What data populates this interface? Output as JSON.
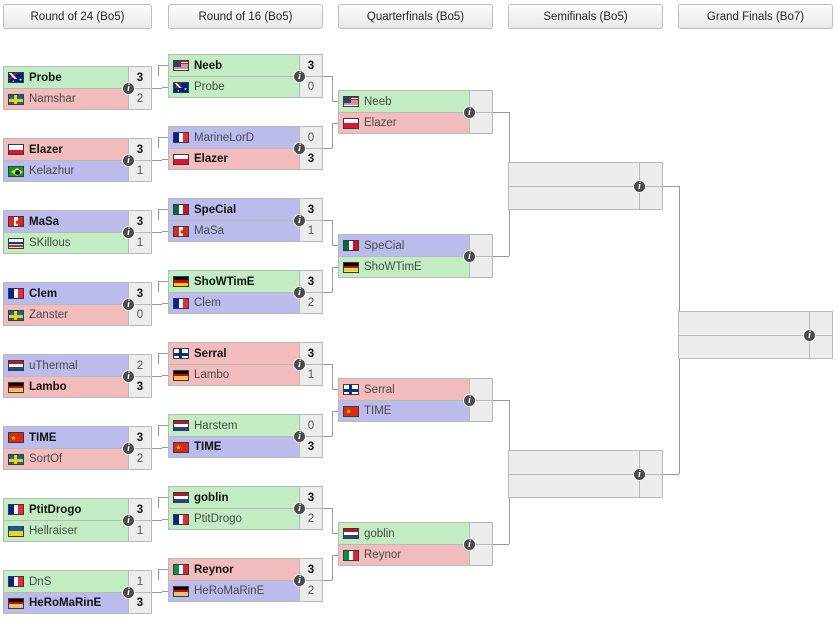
{
  "page": {
    "title": "Tournament Bracket",
    "colors": {
      "protoss_green": "#c2edc2",
      "zerg_red": "#f2bcbc",
      "terran_blue": "#bcbcec",
      "empty_gray": "#ececec",
      "border": "#b9b9b9",
      "line": "#9a9a9a"
    }
  },
  "rounds": [
    {
      "label": "Round of 24 (Bo5)"
    },
    {
      "label": "Round of 16 (Bo5)"
    },
    {
      "label": "Quarterfinals (Bo5)"
    },
    {
      "label": "Semifinals (Bo5)"
    },
    {
      "label": "Grand Finals (Bo7)"
    }
  ],
  "icons": {
    "info": "i",
    "info_name": "match-details-icon"
  },
  "matches": {
    "ro24": [
      {
        "top": {
          "name": "Probe",
          "score": "3",
          "flag": "au",
          "race": "p",
          "winner": true
        },
        "bot": {
          "name": "Namshar",
          "score": "2",
          "flag": "se",
          "race": "z",
          "winner": false
        }
      },
      {
        "top": {
          "name": "Elazer",
          "score": "3",
          "flag": "pl",
          "race": "z",
          "winner": true
        },
        "bot": {
          "name": "Kelazhur",
          "score": "1",
          "flag": "br",
          "race": "t",
          "winner": false
        }
      },
      {
        "top": {
          "name": "MaSa",
          "score": "3",
          "flag": "ca",
          "race": "t",
          "winner": true
        },
        "bot": {
          "name": "SKillous",
          "score": "1",
          "flag": "ru",
          "race": "p",
          "winner": false
        }
      },
      {
        "top": {
          "name": "Clem",
          "score": "3",
          "flag": "fr",
          "race": "t",
          "winner": true
        },
        "bot": {
          "name": "Zanster",
          "score": "0",
          "flag": "se",
          "race": "z",
          "winner": false
        }
      },
      {
        "top": {
          "name": "uThermal",
          "score": "2",
          "flag": "nl",
          "race": "t",
          "winner": false
        },
        "bot": {
          "name": "Lambo",
          "score": "3",
          "flag": "de",
          "race": "z",
          "winner": true
        }
      },
      {
        "top": {
          "name": "TIME",
          "score": "3",
          "flag": "cn",
          "race": "t",
          "winner": true
        },
        "bot": {
          "name": "SortOf",
          "score": "2",
          "flag": "se",
          "race": "z",
          "winner": false
        }
      },
      {
        "top": {
          "name": "PtitDrogo",
          "score": "3",
          "flag": "fr",
          "race": "p",
          "winner": true
        },
        "bot": {
          "name": "Hellraiser",
          "score": "1",
          "flag": "ua",
          "race": "p",
          "winner": false
        }
      },
      {
        "top": {
          "name": "DnS",
          "score": "1",
          "flag": "fr",
          "race": "p",
          "winner": false
        },
        "bot": {
          "name": "HeRoMaRinE",
          "score": "3",
          "flag": "de",
          "race": "t",
          "winner": true
        }
      }
    ],
    "ro16": [
      {
        "top": {
          "name": "Neeb",
          "score": "3",
          "flag": "us",
          "race": "p",
          "winner": true
        },
        "bot": {
          "name": "Probe",
          "score": "0",
          "flag": "au",
          "race": "p",
          "winner": false
        }
      },
      {
        "top": {
          "name": "MarineLorD",
          "score": "0",
          "flag": "fr",
          "race": "t",
          "winner": false
        },
        "bot": {
          "name": "Elazer",
          "score": "3",
          "flag": "pl",
          "race": "z",
          "winner": true
        }
      },
      {
        "top": {
          "name": "SpeCial",
          "score": "3",
          "flag": "mx",
          "race": "t",
          "winner": true
        },
        "bot": {
          "name": "MaSa",
          "score": "1",
          "flag": "ca",
          "race": "t",
          "winner": false
        }
      },
      {
        "top": {
          "name": "ShoWTimE",
          "score": "3",
          "flag": "de",
          "race": "p",
          "winner": true
        },
        "bot": {
          "name": "Clem",
          "score": "2",
          "flag": "fr",
          "race": "t",
          "winner": false
        }
      },
      {
        "top": {
          "name": "Serral",
          "score": "3",
          "flag": "fi",
          "race": "z",
          "winner": true
        },
        "bot": {
          "name": "Lambo",
          "score": "1",
          "flag": "de",
          "race": "z",
          "winner": false
        }
      },
      {
        "top": {
          "name": "Harstem",
          "score": "0",
          "flag": "nl",
          "race": "p",
          "winner": false
        },
        "bot": {
          "name": "TIME",
          "score": "3",
          "flag": "cn",
          "race": "t",
          "winner": true
        }
      },
      {
        "top": {
          "name": "goblin",
          "score": "3",
          "flag": "nl",
          "race": "p",
          "winner": true
        },
        "bot": {
          "name": "PtitDrogo",
          "score": "2",
          "flag": "fr",
          "race": "p",
          "winner": false
        }
      },
      {
        "top": {
          "name": "Reynor",
          "score": "3",
          "flag": "it",
          "race": "z",
          "winner": true
        },
        "bot": {
          "name": "HeRoMaRinE",
          "score": "2",
          "flag": "de",
          "race": "t",
          "winner": false
        }
      }
    ],
    "quarterfinals": [
      {
        "top": {
          "name": "Neeb",
          "score": "",
          "flag": "us",
          "race": "p",
          "winner": false
        },
        "bot": {
          "name": "Elazer",
          "score": "",
          "flag": "pl",
          "race": "z",
          "winner": false
        }
      },
      {
        "top": {
          "name": "SpeCial",
          "score": "",
          "flag": "mx",
          "race": "t",
          "winner": false
        },
        "bot": {
          "name": "ShoWTimE",
          "score": "",
          "flag": "de",
          "race": "p",
          "winner": false
        }
      },
      {
        "top": {
          "name": "Serral",
          "score": "",
          "flag": "fi",
          "race": "z",
          "winner": false
        },
        "bot": {
          "name": "TIME",
          "score": "",
          "flag": "cn",
          "race": "t",
          "winner": false
        }
      },
      {
        "top": {
          "name": "goblin",
          "score": "",
          "flag": "nl",
          "race": "p",
          "winner": false
        },
        "bot": {
          "name": "Reynor",
          "score": "",
          "flag": "it",
          "race": "z",
          "winner": false
        }
      }
    ],
    "semifinals": [
      {
        "top": {
          "name": "",
          "score": "",
          "flag": "",
          "race": "none",
          "winner": false
        },
        "bot": {
          "name": "",
          "score": "",
          "flag": "",
          "race": "none",
          "winner": false
        }
      },
      {
        "top": {
          "name": "",
          "score": "",
          "flag": "",
          "race": "none",
          "winner": false
        },
        "bot": {
          "name": "",
          "score": "",
          "flag": "",
          "race": "none",
          "winner": false
        }
      }
    ],
    "grandfinals": [
      {
        "top": {
          "name": "",
          "score": "",
          "flag": "",
          "race": "none",
          "winner": false
        },
        "bot": {
          "name": "",
          "score": "",
          "flag": "",
          "race": "none",
          "winner": false
        }
      }
    ]
  }
}
